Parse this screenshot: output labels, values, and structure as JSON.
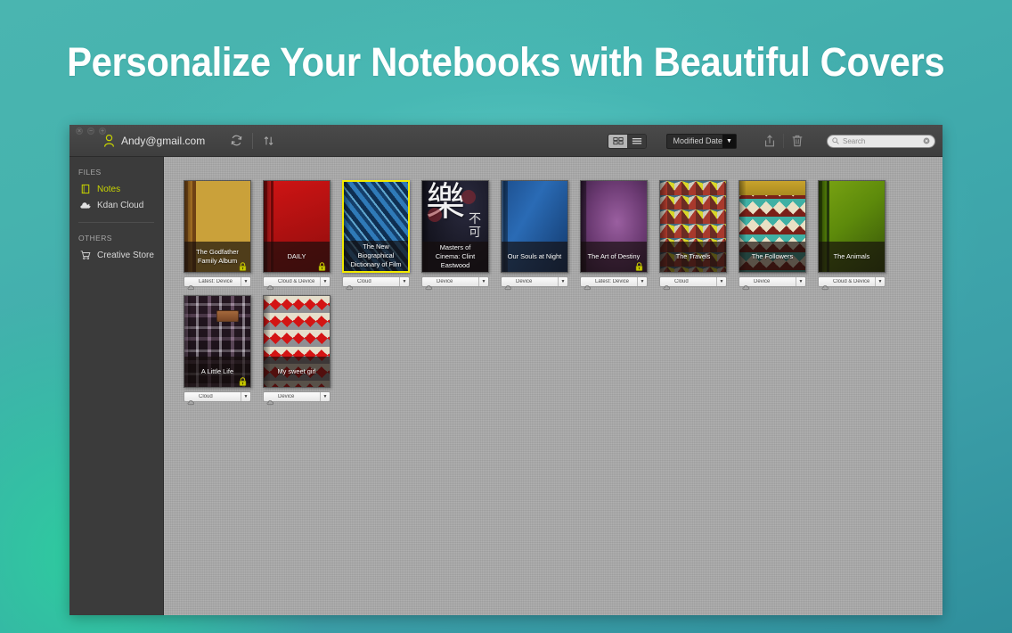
{
  "hero": {
    "title": "Personalize Your Notebooks with Beautiful Covers"
  },
  "window": {
    "traffic_lights": [
      "close",
      "minimize",
      "zoom"
    ]
  },
  "toolbar": {
    "account_email": "Andy@gmail.com",
    "sync_icon": "refresh-icon",
    "sort_icon": "sort-arrows-icon",
    "view_grid_label": "Grid view",
    "view_list_label": "List view",
    "sort_value": "Modified Date",
    "share_icon": "share-icon",
    "trash_icon": "trash-icon",
    "search_placeholder": "Search",
    "search_value": ""
  },
  "sidebar": {
    "sections": [
      {
        "title": "FILES",
        "items": [
          {
            "label": "Notes",
            "icon": "notebook-icon",
            "active": true
          },
          {
            "label": "Kdan Cloud",
            "icon": "cloud-download-icon",
            "active": false
          }
        ]
      },
      {
        "title": "OTHERS",
        "items": [
          {
            "label": "Creative Store",
            "icon": "cart-icon",
            "active": false
          }
        ]
      }
    ]
  },
  "notebooks": [
    {
      "title": "The Godfather Family Album",
      "cover": "cv-godfather",
      "locked": true,
      "selected": false,
      "status": "Latest: Device"
    },
    {
      "title": "DAILY",
      "cover": "cv-daily",
      "locked": true,
      "selected": false,
      "status": "Cloud & Device"
    },
    {
      "title": "The New Biographical Dictionary of Film",
      "cover": "cv-biog",
      "locked": false,
      "selected": true,
      "status": "Cloud"
    },
    {
      "title": "Masters of Cinema: Clint Eastwood",
      "cover": "cv-masters",
      "locked": false,
      "selected": false,
      "status": "Device"
    },
    {
      "title": "Our Souls at Night",
      "cover": "cv-souls",
      "locked": false,
      "selected": false,
      "status": "Device"
    },
    {
      "title": "The Art of Destiny",
      "cover": "cv-destiny",
      "locked": true,
      "selected": false,
      "status": "Latest: Device"
    },
    {
      "title": "The Travels",
      "cover": "cv-travels",
      "locked": false,
      "selected": false,
      "status": "Cloud"
    },
    {
      "title": "The Followers",
      "cover": "cv-followers",
      "locked": false,
      "selected": false,
      "status": "Device"
    },
    {
      "title": "The Animals",
      "cover": "cv-animals",
      "locked": false,
      "selected": false,
      "status": "Cloud & Device"
    },
    {
      "title": "A Little Life",
      "cover": "cv-alittle",
      "locked": true,
      "selected": false,
      "status": "Cloud"
    },
    {
      "title": "My sweet girl",
      "cover": "cv-sweet",
      "locked": false,
      "selected": false,
      "status": "Device"
    }
  ],
  "colors": {
    "accent_green": "#c8d400",
    "selection_yellow": "#f2ea00",
    "window_chrome": "#3b3b3b",
    "content_bg": "#a9a9a9",
    "hero_bg_teal": "#46b3ae"
  }
}
